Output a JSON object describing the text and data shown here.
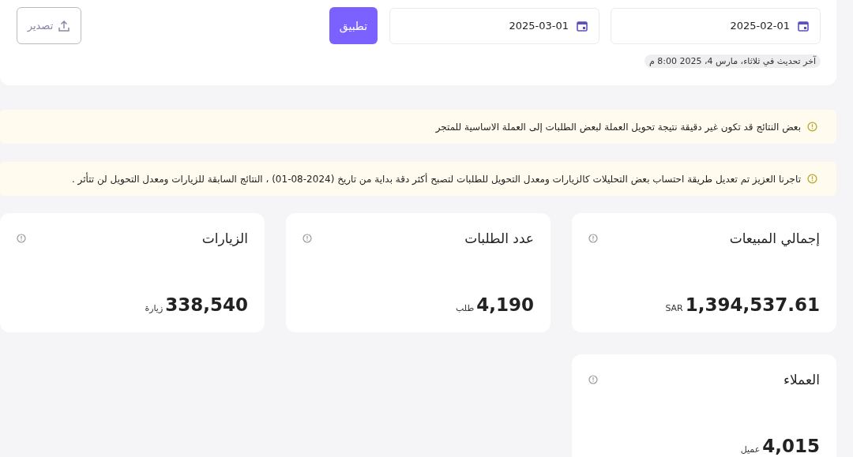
{
  "filters": {
    "date_from": "2025-02-01",
    "date_to": "2025-03-01",
    "apply_label": "تطبيق",
    "export_label": "تصدير",
    "last_updated": "آخر تحديث في ثلاثاء، مارس 4، 2025 8:00 م"
  },
  "alerts": [
    {
      "text": "بعض النتائج قد تكون غير دقيقة نتيجة تحويل العملة لبعض الطلبات إلى العملة الاساسية للمتجر"
    },
    {
      "text": "تاجرنا العزيز تم تعديل طريقة احتساب بعض التحليلات كالزيارات ومعدل التحويل للطلبات لتصبح أكثر دقة بداية من تاريخ (2024-08-01) ، النتائج السابقة للزيارات ومعدل التحويل لن تتأثر ."
    }
  ],
  "stats": [
    {
      "title": "إجمالي المبيعات",
      "value": "1,394,537.61",
      "unit": "SAR"
    },
    {
      "title": "عدد الطلبات",
      "value": "4,190",
      "unit": "طلب"
    },
    {
      "title": "الزيارات",
      "value": "338,540",
      "unit": "زيارة"
    },
    {
      "title": "العملاء",
      "value": "4,015",
      "unit": "عميل"
    }
  ]
}
